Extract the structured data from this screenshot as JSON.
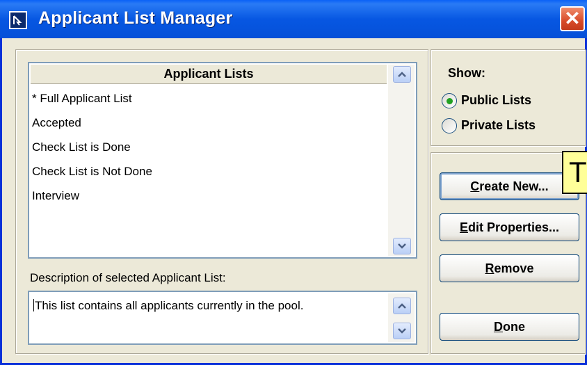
{
  "window": {
    "title": "Applicant List Manager",
    "close_glyph": "✕",
    "colors": {
      "titlebar": "#0757E2",
      "close": "#D84B2A",
      "face": "#ECE9D8"
    }
  },
  "lists": {
    "header": "Applicant Lists",
    "items": [
      "* Full Applicant List",
      "Accepted",
      "Check List is Done",
      "Check List is Not Done",
      "Interview"
    ]
  },
  "description": {
    "label": "Description of selected Applicant List:",
    "text": "This list contains all applicants currently in the pool."
  },
  "show": {
    "label": "Show:",
    "options": [
      {
        "label": "Public Lists",
        "selected": true
      },
      {
        "label": "Private Lists",
        "selected": false
      }
    ]
  },
  "buttons": {
    "create": {
      "key": "C",
      "rest": "reate New..."
    },
    "edit": {
      "key": "E",
      "rest": "dit Properties..."
    },
    "remove": {
      "key": "R",
      "rest": "emove"
    },
    "done": {
      "key": "D",
      "rest": "one"
    }
  },
  "tooltip": {
    "text": "T"
  }
}
